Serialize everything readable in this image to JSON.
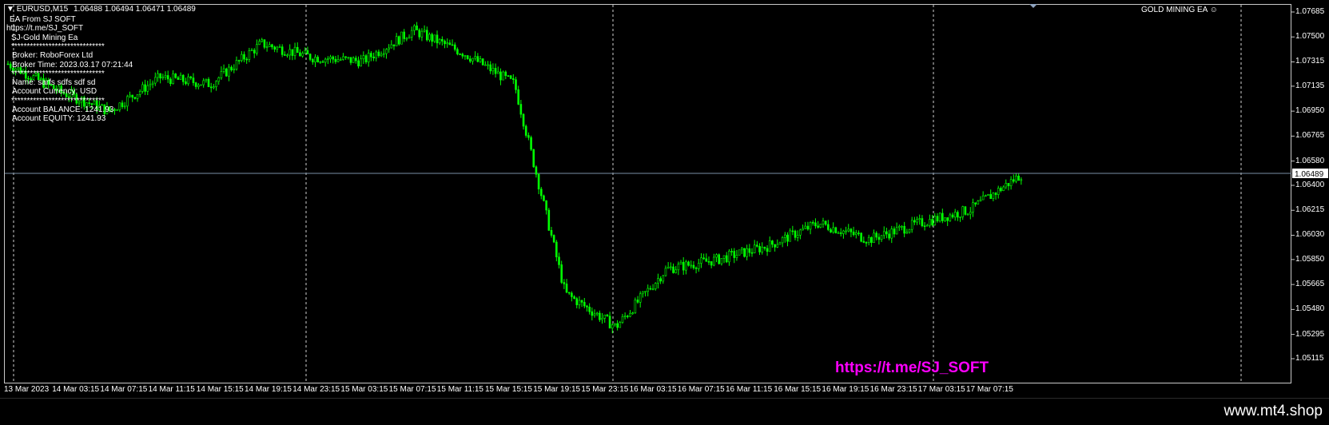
{
  "header": {
    "symbol": "EURUSD,M15",
    "ohlc": "1.06488 1.06494 1.06471 1.06489",
    "indicator_name": "GOLD MINING EA"
  },
  "info_panel": {
    "lines": [
      "EA From SJ SOFT",
      "https://t.me/SJ_SOFT",
      "SJ-Gold Mining Ea",
      "******************************",
      "Broker: RoboForex Ltd",
      "Broker Time: 2023.03.17 07:21:44",
      "******************************",
      "Name: sarfs   sdfs sdf  sd",
      "Account Currency: USD",
      "******************************",
      "Account BALANCE: 1241.93",
      "Account EQUITY: 1241.93"
    ]
  },
  "watermark": "https://t.me/SJ_SOFT",
  "footer_url": "www.mt4.shop",
  "colors": {
    "background": "#000000",
    "candle": "#00ff00",
    "grid": "#c8c8c8",
    "current_price_line": "#7a8fa6",
    "watermark": "#ff00ff"
  },
  "current_price": "1.06489",
  "price_ticks": [
    "1.07685",
    "1.07500",
    "1.07315",
    "1.07135",
    "1.06950",
    "1.06765",
    "1.06580",
    "1.06400",
    "1.06215",
    "1.06030",
    "1.05850",
    "1.05665",
    "1.05480",
    "1.05295",
    "1.05115"
  ],
  "time_ticks": [
    "13 Mar 2023",
    "14 Mar 03:15",
    "14 Mar 07:15",
    "14 Mar 11:15",
    "14 Mar 15:15",
    "14 Mar 19:15",
    "14 Mar 23:15",
    "15 Mar 03:15",
    "15 Mar 07:15",
    "15 Mar 11:15",
    "15 Mar 15:15",
    "15 Mar 19:15",
    "15 Mar 23:15",
    "16 Mar 03:15",
    "16 Mar 07:15",
    "16 Mar 11:15",
    "16 Mar 15:15",
    "16 Mar 19:15",
    "16 Mar 23:15",
    "17 Mar 03:15",
    "17 Mar 07:15"
  ],
  "chart_data": {
    "type": "line",
    "symbol": "EURUSD",
    "timeframe": "M15",
    "ylim": [
      1.05115,
      1.07685
    ],
    "x": [
      "13 Mar 2023",
      "14 Mar 03:15",
      "14 Mar 07:15",
      "14 Mar 11:15",
      "14 Mar 15:15",
      "14 Mar 19:15",
      "14 Mar 23:15",
      "15 Mar 03:15",
      "15 Mar 07:15",
      "15 Mar 11:15",
      "15 Mar 15:15",
      "15 Mar 19:15",
      "15 Mar 23:15",
      "16 Mar 03:15",
      "16 Mar 07:15",
      "16 Mar 11:15",
      "16 Mar 15:15",
      "16 Mar 19:15",
      "16 Mar 23:15",
      "17 Mar 03:15",
      "17 Mar 07:15"
    ],
    "series": [
      {
        "values": [
          1.073,
          1.071,
          1.0695,
          1.072,
          1.0715,
          1.0745,
          1.0735,
          1.0732,
          1.0755,
          1.0738,
          1.0715,
          1.056,
          1.0535,
          1.0578,
          1.0585,
          1.0595,
          1.0612,
          1.06,
          1.0612,
          1.0622,
          1.0648
        ]
      }
    ]
  }
}
